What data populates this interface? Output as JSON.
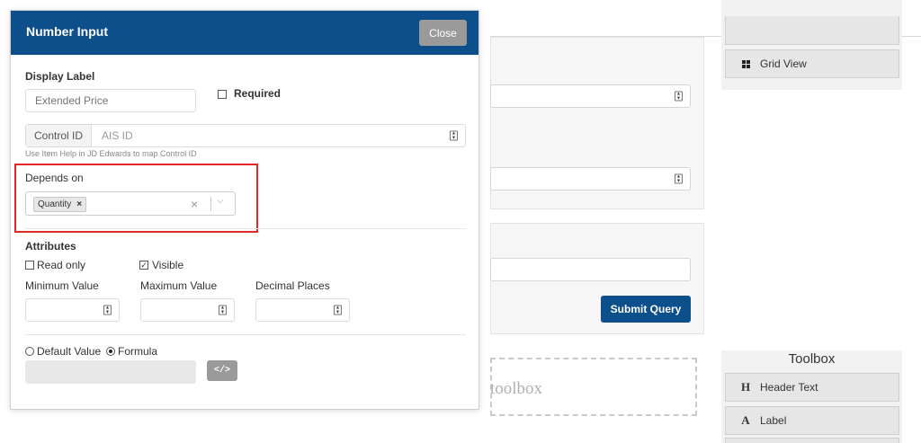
{
  "modal": {
    "title": "Number Input",
    "close_label": "Close",
    "display_label": {
      "heading": "Display Label",
      "placeholder": "Extended Price"
    },
    "required_label": "Required",
    "control_id": {
      "addon": "Control ID",
      "placeholder": "AIS ID",
      "hint": "Use Item Help in JD Edwards to map Control ID"
    },
    "depends_on": {
      "heading": "Depends on",
      "selected_chip": "Quantity",
      "chip_remove": "×",
      "clear_icon": "×",
      "dropdown_icon": "⌵"
    },
    "attributes": {
      "heading": "Attributes",
      "read_only_label": "Read only",
      "read_only_checked": false,
      "visible_label": "Visible",
      "visible_checked": true,
      "visible_mark": "✓",
      "min_label": "Minimum Value",
      "max_label": "Maximum Value",
      "decimal_label": "Decimal Places"
    },
    "value_mode": {
      "default_label": "Default Value",
      "formula_label": "Formula",
      "selected": "formula",
      "code_button": "</>"
    }
  },
  "background": {
    "submit_label": "Submit Query",
    "dropzone_text": "toolbox",
    "sidebar_top": {
      "grid_view_label": "Grid View"
    },
    "toolbox": {
      "title": "Toolbox",
      "items": [
        {
          "icon": "H",
          "label": "Header Text"
        },
        {
          "icon": "A",
          "label": "Label"
        }
      ]
    }
  },
  "colors": {
    "header_blue": "#0d4f8b",
    "highlight_red": "#e32626",
    "close_grey": "#9a9a9a"
  }
}
